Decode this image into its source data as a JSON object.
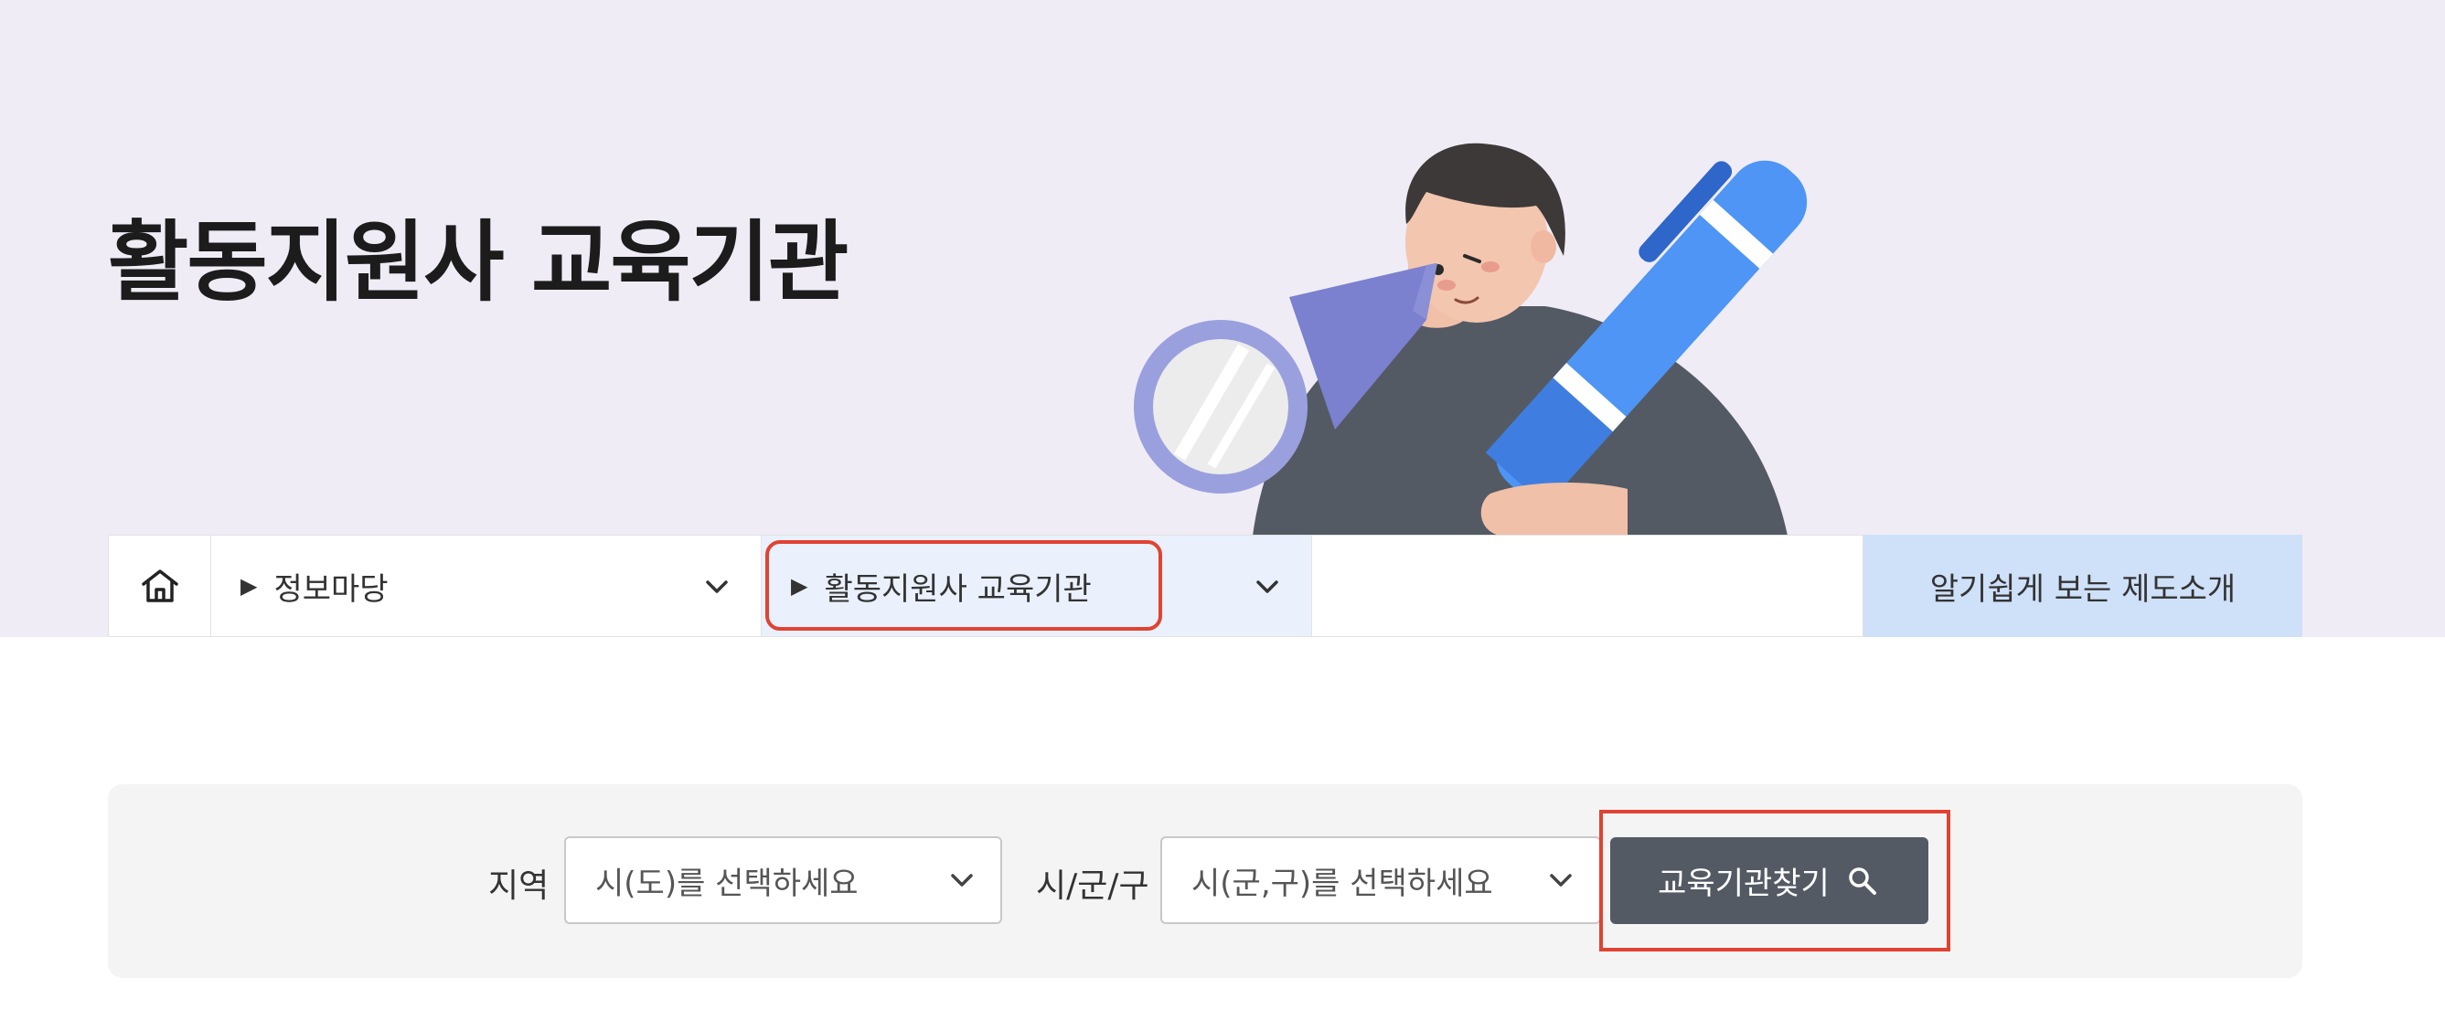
{
  "hero": {
    "title": "활동지원사 교육기관"
  },
  "nav": {
    "home_icon": "home-icon",
    "menu1": "정보마당",
    "menu2": "활동지원사 교육기관",
    "intro_link": "알기쉽게 보는 제도소개"
  },
  "search": {
    "region_label": "지역",
    "region_select": "시(도)를 선택하세요",
    "district_label": "시/군/구",
    "district_select": "시(군,구)를 선택하세요",
    "button_label": "교육기관찾기",
    "button_icon": "search-icon"
  },
  "colors": {
    "hero_bg": "#efecf6",
    "active_menu_bg": "#eaf1fc",
    "intro_bg": "#cfe0f9",
    "button_bg": "#545a64",
    "highlight": "#e04332"
  }
}
